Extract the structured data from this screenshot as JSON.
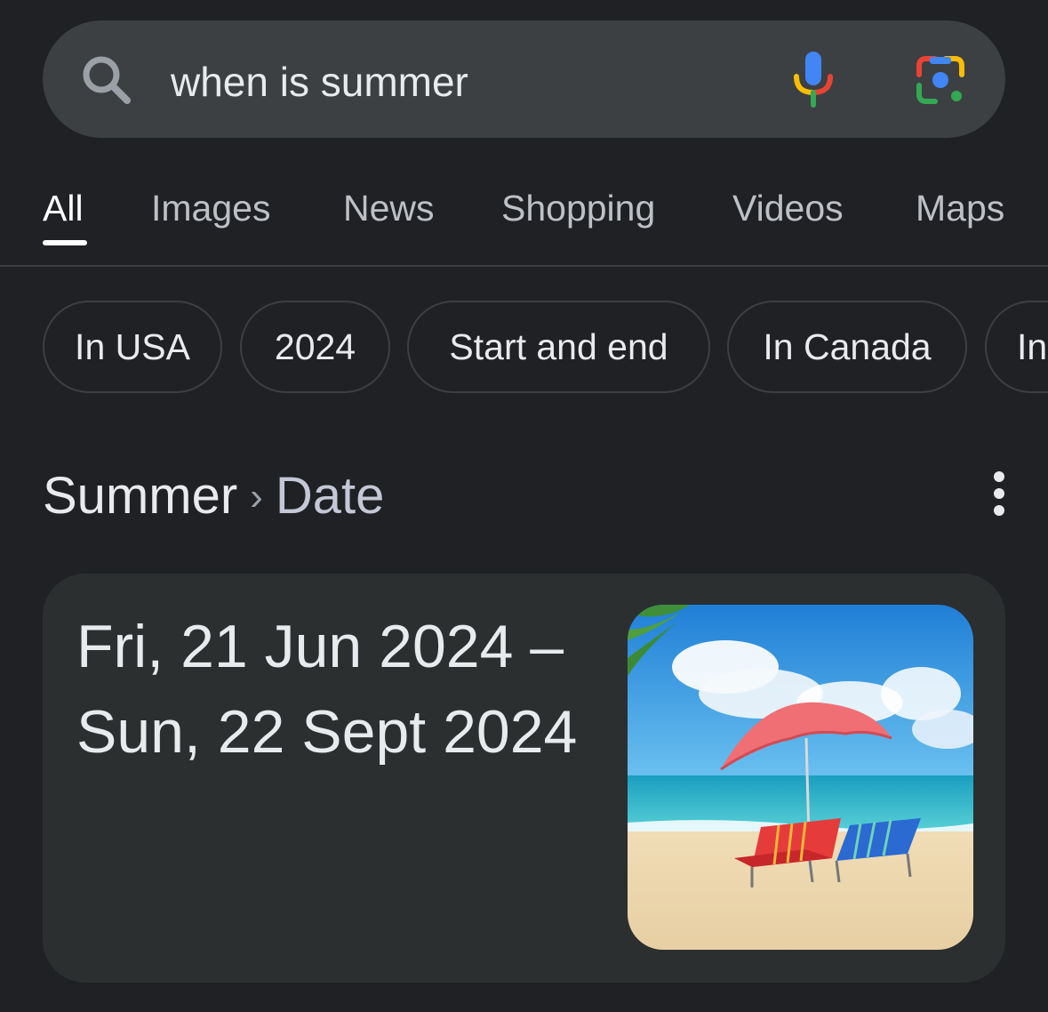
{
  "search": {
    "query": "when is summer"
  },
  "tabs": [
    {
      "label": "All",
      "active": true
    },
    {
      "label": "Images",
      "active": false
    },
    {
      "label": "News",
      "active": false
    },
    {
      "label": "Shopping",
      "active": false
    },
    {
      "label": "Videos",
      "active": false
    },
    {
      "label": "Maps",
      "active": false
    }
  ],
  "chips": [
    {
      "label": "In USA"
    },
    {
      "label": "2024"
    },
    {
      "label": "Start and end"
    },
    {
      "label": "In Canada"
    },
    {
      "label": "In"
    }
  ],
  "result": {
    "title": "Summer",
    "separator": "›",
    "subtitle": "Date",
    "date_line1": "Fri, 21 Jun 2024 –",
    "date_line2": "Sun, 22 Sept 2024"
  },
  "icons": {
    "search": "search-icon",
    "mic": "mic-icon",
    "lens": "lens-icon",
    "more": "more-vert-icon"
  },
  "colors": {
    "background": "#202124",
    "search_bar": "#3c4043",
    "card": "#2b2f30",
    "text": "#e8eaed",
    "muted_text": "#bdc1c6"
  }
}
